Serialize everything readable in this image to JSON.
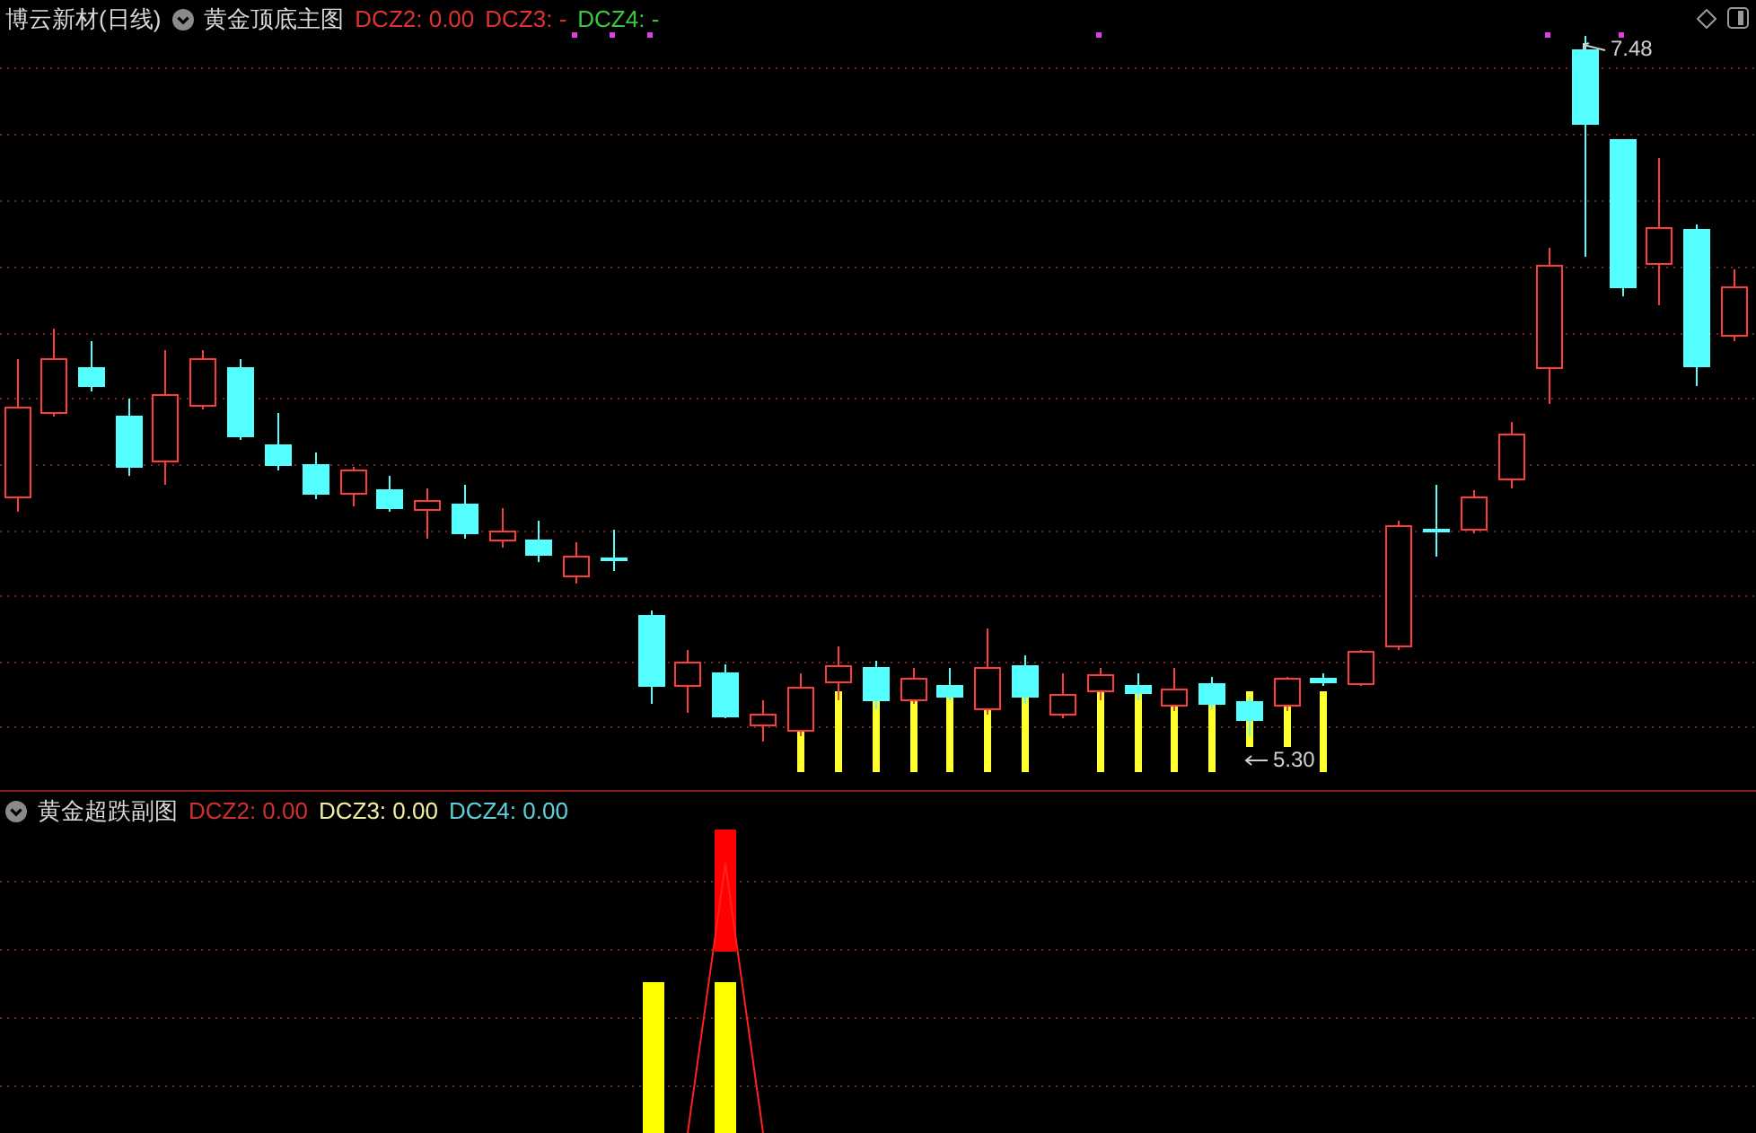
{
  "main_chart": {
    "stock": "博云新材(日线)",
    "indicator": "黄金顶底主图",
    "values": [
      {
        "label": "DCZ2: 0.00",
        "color": "#e03232"
      },
      {
        "label": "DCZ3: -",
        "color": "#e03232"
      },
      {
        "label": "DCZ4: -",
        "color": "#3cc83c"
      }
    ],
    "high_label": "7.48",
    "low_label": "5.30"
  },
  "sub_chart": {
    "indicator": "黄金超跌副图",
    "values": [
      {
        "label": "DCZ2: 0.00",
        "color": "#d03030"
      },
      {
        "label": "DCZ3: 0.00",
        "color": "#f0f0a0"
      },
      {
        "label": "DCZ4: 0.00",
        "color": "#60d0d8"
      }
    ]
  }
}
